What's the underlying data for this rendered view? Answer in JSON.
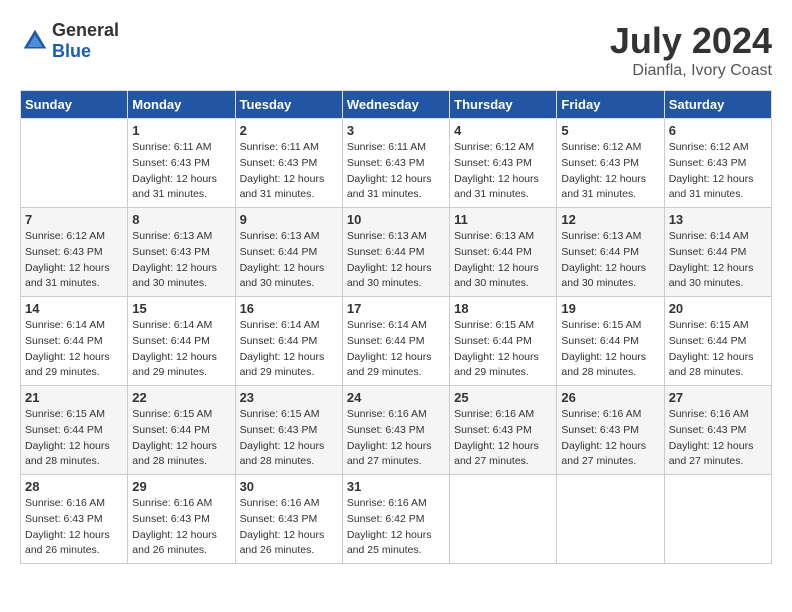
{
  "logo": {
    "general": "General",
    "blue": "Blue"
  },
  "title": "July 2024",
  "subtitle": "Dianfla, Ivory Coast",
  "days_of_week": [
    "Sunday",
    "Monday",
    "Tuesday",
    "Wednesday",
    "Thursday",
    "Friday",
    "Saturday"
  ],
  "weeks": [
    [
      {
        "day": "",
        "info": ""
      },
      {
        "day": "1",
        "info": "Sunrise: 6:11 AM\nSunset: 6:43 PM\nDaylight: 12 hours\nand 31 minutes."
      },
      {
        "day": "2",
        "info": "Sunrise: 6:11 AM\nSunset: 6:43 PM\nDaylight: 12 hours\nand 31 minutes."
      },
      {
        "day": "3",
        "info": "Sunrise: 6:11 AM\nSunset: 6:43 PM\nDaylight: 12 hours\nand 31 minutes."
      },
      {
        "day": "4",
        "info": "Sunrise: 6:12 AM\nSunset: 6:43 PM\nDaylight: 12 hours\nand 31 minutes."
      },
      {
        "day": "5",
        "info": "Sunrise: 6:12 AM\nSunset: 6:43 PM\nDaylight: 12 hours\nand 31 minutes."
      },
      {
        "day": "6",
        "info": "Sunrise: 6:12 AM\nSunset: 6:43 PM\nDaylight: 12 hours\nand 31 minutes."
      }
    ],
    [
      {
        "day": "7",
        "info": "Sunrise: 6:12 AM\nSunset: 6:43 PM\nDaylight: 12 hours\nand 31 minutes."
      },
      {
        "day": "8",
        "info": "Sunrise: 6:13 AM\nSunset: 6:43 PM\nDaylight: 12 hours\nand 30 minutes."
      },
      {
        "day": "9",
        "info": "Sunrise: 6:13 AM\nSunset: 6:44 PM\nDaylight: 12 hours\nand 30 minutes."
      },
      {
        "day": "10",
        "info": "Sunrise: 6:13 AM\nSunset: 6:44 PM\nDaylight: 12 hours\nand 30 minutes."
      },
      {
        "day": "11",
        "info": "Sunrise: 6:13 AM\nSunset: 6:44 PM\nDaylight: 12 hours\nand 30 minutes."
      },
      {
        "day": "12",
        "info": "Sunrise: 6:13 AM\nSunset: 6:44 PM\nDaylight: 12 hours\nand 30 minutes."
      },
      {
        "day": "13",
        "info": "Sunrise: 6:14 AM\nSunset: 6:44 PM\nDaylight: 12 hours\nand 30 minutes."
      }
    ],
    [
      {
        "day": "14",
        "info": "Sunrise: 6:14 AM\nSunset: 6:44 PM\nDaylight: 12 hours\nand 29 minutes."
      },
      {
        "day": "15",
        "info": "Sunrise: 6:14 AM\nSunset: 6:44 PM\nDaylight: 12 hours\nand 29 minutes."
      },
      {
        "day": "16",
        "info": "Sunrise: 6:14 AM\nSunset: 6:44 PM\nDaylight: 12 hours\nand 29 minutes."
      },
      {
        "day": "17",
        "info": "Sunrise: 6:14 AM\nSunset: 6:44 PM\nDaylight: 12 hours\nand 29 minutes."
      },
      {
        "day": "18",
        "info": "Sunrise: 6:15 AM\nSunset: 6:44 PM\nDaylight: 12 hours\nand 29 minutes."
      },
      {
        "day": "19",
        "info": "Sunrise: 6:15 AM\nSunset: 6:44 PM\nDaylight: 12 hours\nand 28 minutes."
      },
      {
        "day": "20",
        "info": "Sunrise: 6:15 AM\nSunset: 6:44 PM\nDaylight: 12 hours\nand 28 minutes."
      }
    ],
    [
      {
        "day": "21",
        "info": "Sunrise: 6:15 AM\nSunset: 6:44 PM\nDaylight: 12 hours\nand 28 minutes."
      },
      {
        "day": "22",
        "info": "Sunrise: 6:15 AM\nSunset: 6:44 PM\nDaylight: 12 hours\nand 28 minutes."
      },
      {
        "day": "23",
        "info": "Sunrise: 6:15 AM\nSunset: 6:43 PM\nDaylight: 12 hours\nand 28 minutes."
      },
      {
        "day": "24",
        "info": "Sunrise: 6:16 AM\nSunset: 6:43 PM\nDaylight: 12 hours\nand 27 minutes."
      },
      {
        "day": "25",
        "info": "Sunrise: 6:16 AM\nSunset: 6:43 PM\nDaylight: 12 hours\nand 27 minutes."
      },
      {
        "day": "26",
        "info": "Sunrise: 6:16 AM\nSunset: 6:43 PM\nDaylight: 12 hours\nand 27 minutes."
      },
      {
        "day": "27",
        "info": "Sunrise: 6:16 AM\nSunset: 6:43 PM\nDaylight: 12 hours\nand 27 minutes."
      }
    ],
    [
      {
        "day": "28",
        "info": "Sunrise: 6:16 AM\nSunset: 6:43 PM\nDaylight: 12 hours\nand 26 minutes."
      },
      {
        "day": "29",
        "info": "Sunrise: 6:16 AM\nSunset: 6:43 PM\nDaylight: 12 hours\nand 26 minutes."
      },
      {
        "day": "30",
        "info": "Sunrise: 6:16 AM\nSunset: 6:43 PM\nDaylight: 12 hours\nand 26 minutes."
      },
      {
        "day": "31",
        "info": "Sunrise: 6:16 AM\nSunset: 6:42 PM\nDaylight: 12 hours\nand 25 minutes."
      },
      {
        "day": "",
        "info": ""
      },
      {
        "day": "",
        "info": ""
      },
      {
        "day": "",
        "info": ""
      }
    ]
  ]
}
